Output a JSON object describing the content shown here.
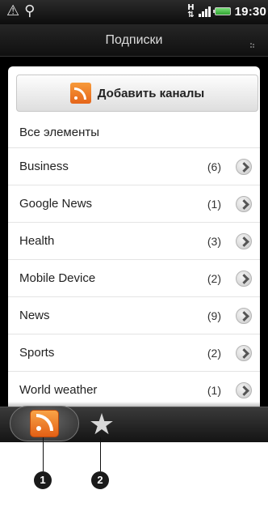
{
  "statusbar": {
    "alert_icon": "warning-triangle-icon",
    "usb_icon": "usb-icon",
    "data_indicator": "H",
    "time": "19:30"
  },
  "header": {
    "title": "Подписки"
  },
  "add_button": {
    "label": "Добавить каналы",
    "icon": "rss-icon"
  },
  "all_items_label": "Все элементы",
  "feeds": [
    {
      "name": "Business",
      "count": "(6)"
    },
    {
      "name": "Google News",
      "count": "(1)"
    },
    {
      "name": "Health",
      "count": "(3)"
    },
    {
      "name": "Mobile Device",
      "count": "(2)"
    },
    {
      "name": "News",
      "count": "(9)"
    },
    {
      "name": "Sports",
      "count": "(2)"
    },
    {
      "name": "World weather",
      "count": "(1)"
    }
  ],
  "tabs": [
    {
      "icon": "rss-icon",
      "selected": true
    },
    {
      "icon": "star-icon",
      "selected": false
    }
  ],
  "callouts": [
    "1",
    "2"
  ],
  "colors": {
    "rss_orange": "#e8701f",
    "background": "#000000",
    "list_bg": "#ffffff"
  }
}
